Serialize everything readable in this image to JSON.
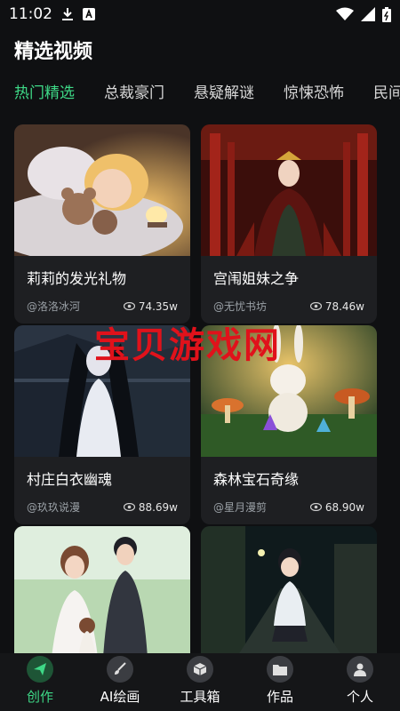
{
  "status": {
    "time": "11:02"
  },
  "header": {
    "title": "精选视频"
  },
  "tabs": [
    {
      "label": "热门精选",
      "active": true
    },
    {
      "label": "总裁豪门"
    },
    {
      "label": "悬疑解谜"
    },
    {
      "label": "惊悚恐怖"
    },
    {
      "label": "民间"
    }
  ],
  "cards": [
    {
      "title": "莉莉的发光礼物",
      "author": "@洛洛冰河",
      "views": "74.35w"
    },
    {
      "title": "宫闱姐妹之争",
      "author": "@无忧书坊",
      "views": "78.46w"
    },
    {
      "title": "村庄白衣幽魂",
      "author": "@玖玖说漫",
      "views": "88.69w"
    },
    {
      "title": "森林宝石奇缘",
      "author": "@星月漫剪",
      "views": "68.90w"
    },
    {
      "title": "",
      "author": "",
      "views": ""
    },
    {
      "title": "",
      "author": "",
      "views": ""
    }
  ],
  "watermark": "宝贝游戏网",
  "bottom_nav": [
    {
      "label": "创作",
      "icon": "paper-plane-icon",
      "active": true
    },
    {
      "label": "AI绘画",
      "icon": "brush-icon"
    },
    {
      "label": "工具箱",
      "icon": "box-icon"
    },
    {
      "label": "作品",
      "icon": "folder-icon"
    },
    {
      "label": "个人",
      "icon": "person-icon"
    }
  ],
  "colors": {
    "accent": "#3ed987",
    "background": "#0f1012",
    "card": "#1e1f22",
    "watermark": "#e0121b"
  }
}
